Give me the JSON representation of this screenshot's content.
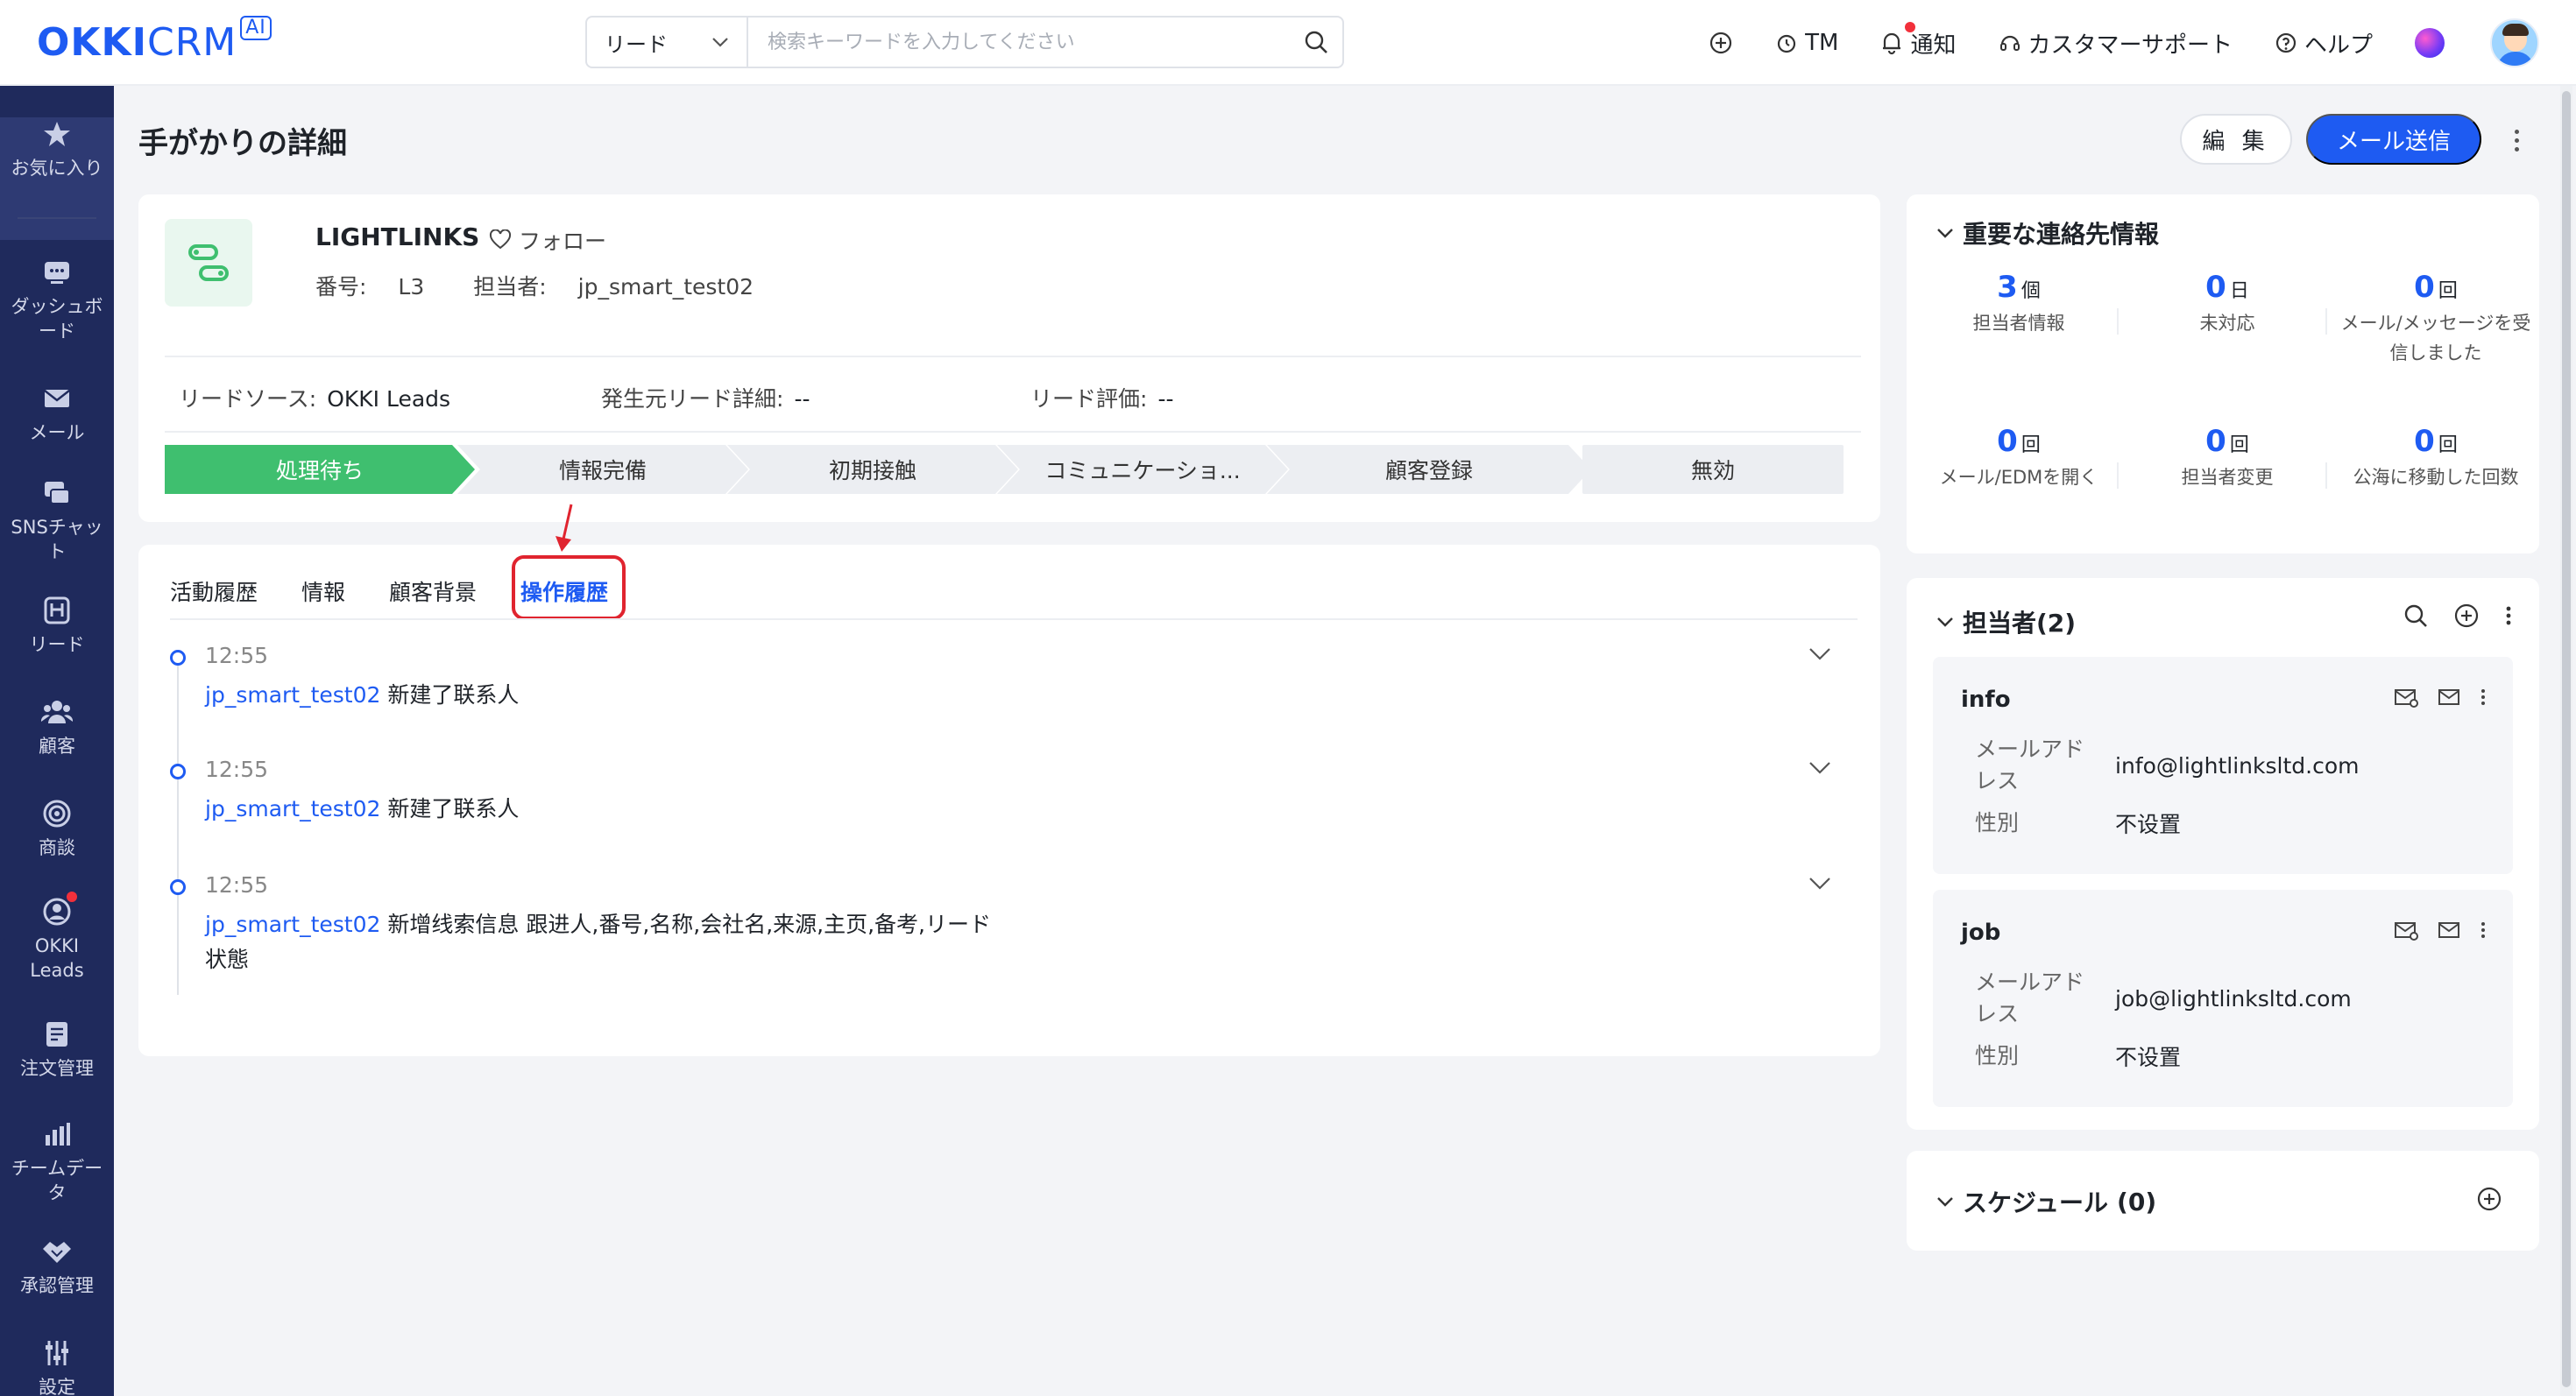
{
  "brand": {
    "okki": "OKKI",
    "crm": "CRM",
    "ai": "AI"
  },
  "search": {
    "select_value": "リード",
    "placeholder": "検索キーワードを入力してください"
  },
  "top_actions": {
    "tm": "TM",
    "notice": "通知",
    "support": "カスタマーサポート",
    "help": "ヘルプ"
  },
  "sidebar": {
    "items": [
      {
        "label": "お気に入り",
        "icon": "star-icon"
      },
      {
        "label": "ダッシュボード",
        "icon": "dashboard-icon"
      },
      {
        "label": "メール",
        "icon": "mail-icon"
      },
      {
        "label": "SNSチャット",
        "icon": "chat-icon"
      },
      {
        "label": "リード",
        "icon": "lead-icon"
      },
      {
        "label": "顧客",
        "icon": "customers-icon"
      },
      {
        "label": "商談",
        "icon": "target-icon"
      },
      {
        "label": "OKKI Leads",
        "icon": "okki-leads-icon"
      },
      {
        "label": "注文管理",
        "icon": "order-icon"
      },
      {
        "label": "チームデータ",
        "icon": "bar-chart-icon"
      },
      {
        "label": "承認管理",
        "icon": "approval-icon"
      },
      {
        "label": "設定",
        "icon": "settings-icon"
      }
    ]
  },
  "page": {
    "title": "手がかりの詳細",
    "edit_label": "編 集",
    "mail_label": "メール送信"
  },
  "lead": {
    "name": "LIGHTLINKS",
    "follow": "フォロー",
    "number_label": "番号:",
    "number": "L3",
    "owner_label": "担当者:",
    "owner": "jp_smart_test02",
    "fields": [
      {
        "label": "リードソース:",
        "value": "OKKI Leads"
      },
      {
        "label": "発生元リード詳細:",
        "value": "--"
      },
      {
        "label": "リード評価:",
        "value": "--"
      }
    ],
    "stages": [
      "処理待ち",
      "情報完備",
      "初期接触",
      "コミュニケーショ...",
      "顧客登録",
      "無効"
    ],
    "current_stage": "処理待ち"
  },
  "activity": {
    "tabs": [
      "活動履歴",
      "情報",
      "顧客背景",
      "操作履歴"
    ],
    "active_tab": "操作履歴",
    "entries": [
      {
        "time": "12:55",
        "user": "jp_smart_test02",
        "text": "新建了联系人"
      },
      {
        "time": "12:55",
        "user": "jp_smart_test02",
        "text": "新建了联系人"
      },
      {
        "time": "12:55",
        "user": "jp_smart_test02",
        "text": "新增线索信息 跟进人,番号,名称,会社名,来源,主页,备考,リード状態"
      }
    ]
  },
  "key_contact": {
    "title": "重要な連絡先情報",
    "stats": [
      {
        "num": "3",
        "unit": "個",
        "label": "担当者情報"
      },
      {
        "num": "0",
        "unit": "日",
        "label": "未対応"
      },
      {
        "num": "0",
        "unit": "回",
        "label": "メール/メッセージを受信しました"
      },
      {
        "num": "0",
        "unit": "回",
        "label": "メール/EDMを開く"
      },
      {
        "num": "0",
        "unit": "回",
        "label": "担当者変更"
      },
      {
        "num": "0",
        "unit": "回",
        "label": "公海に移動した回数"
      }
    ]
  },
  "contacts": {
    "title": "担当者(2)",
    "email_label": "メールアドレス",
    "gender_label": "性別",
    "items": [
      {
        "name": "info",
        "email": "info@lightlinksltd.com",
        "gender": "不设置"
      },
      {
        "name": "job",
        "email": "job@lightlinksltd.com",
        "gender": "不设置"
      }
    ]
  },
  "schedule": {
    "title": "スケジュール",
    "count": "(0)"
  },
  "colors": {
    "primary": "#1e5bf2",
    "success": "#3fbf6f",
    "sidebar": "#1f2a5c",
    "alert": "#e0242f"
  }
}
